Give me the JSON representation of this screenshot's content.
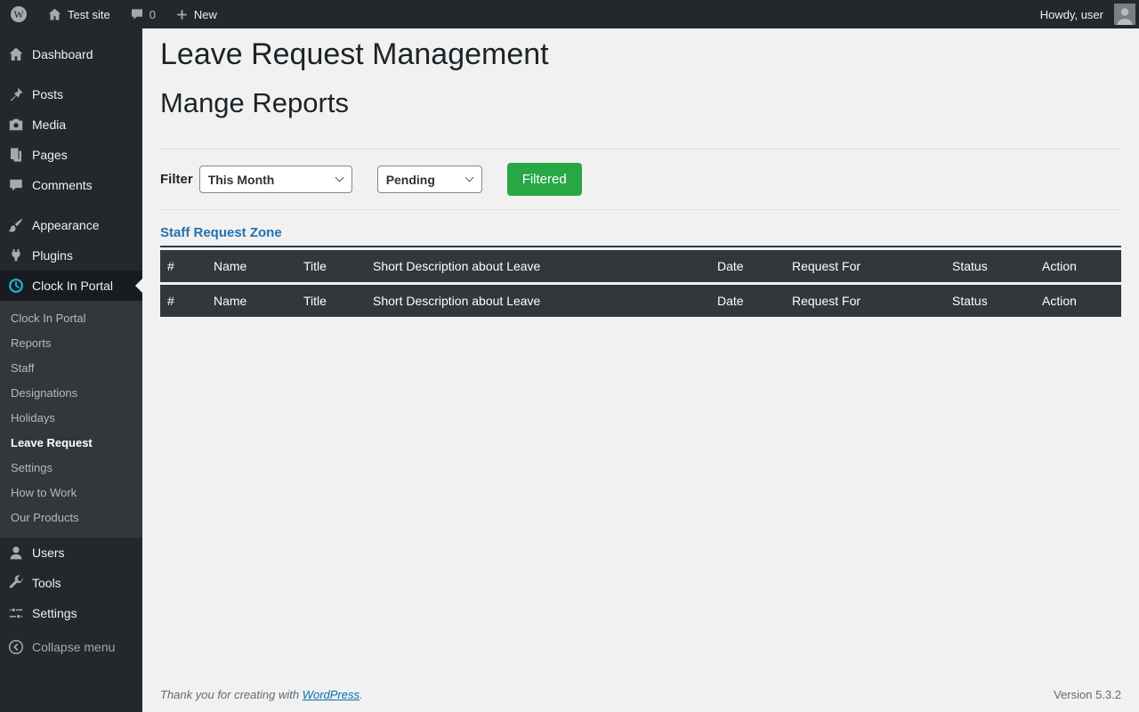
{
  "admin_bar": {
    "site_name": "Test site",
    "comments_count": "0",
    "new_label": "New",
    "howdy_text": "Howdy, user"
  },
  "sidebar": {
    "items": [
      {
        "label": "Dashboard"
      },
      {
        "label": "Posts"
      },
      {
        "label": "Media"
      },
      {
        "label": "Pages"
      },
      {
        "label": "Comments"
      },
      {
        "label": "Appearance"
      },
      {
        "label": "Plugins"
      },
      {
        "label": "Clock In Portal"
      },
      {
        "label": "Users"
      },
      {
        "label": "Tools"
      },
      {
        "label": "Settings"
      }
    ],
    "submenu": [
      {
        "label": "Clock In Portal"
      },
      {
        "label": "Reports"
      },
      {
        "label": "Staff"
      },
      {
        "label": "Designations"
      },
      {
        "label": "Holidays"
      },
      {
        "label": "Leave Request",
        "current": true
      },
      {
        "label": "Settings"
      },
      {
        "label": "How to Work"
      },
      {
        "label": "Our Products"
      }
    ],
    "collapse_label": "Collapse menu"
  },
  "page": {
    "title": "Leave Request Management",
    "subtitle": "Mange Reports",
    "filter": {
      "label": "Filter",
      "period_selected": "This Month",
      "status_selected": "Pending",
      "button_label": "Filtered"
    },
    "section_title": "Staff Request Zone",
    "table": {
      "columns": [
        "#",
        "Name",
        "Title",
        "Short Description about Leave",
        "Date",
        "Request For",
        "Status",
        "Action"
      ],
      "rows": [
        [
          "#",
          "Name",
          "Title",
          "Short Description about Leave",
          "Date",
          "Request For",
          "Status",
          "Action"
        ]
      ]
    }
  },
  "footer": {
    "thanks_text": "Thank you for creating with",
    "wordpress_link": "WordPress",
    "period": ".",
    "version": "Version 5.3.2"
  },
  "colors": {
    "admin_dark": "#23282d",
    "submenu_bg": "#32373c",
    "current_item_bg": "#181c20",
    "content_bg": "#f1f1f1",
    "accent_green": "#28a745",
    "section_blue": "#2271b1",
    "table_header_bg": "#32373c",
    "clock_icon_teal": "#1fb6cf"
  },
  "icons": [
    "wordpress-logo",
    "home",
    "comment-bubble",
    "plus",
    "dashboard-house",
    "posts-pin",
    "media-camera",
    "pages",
    "comments-bubble",
    "appearance-brush",
    "plugins-plug",
    "clock",
    "users-person",
    "tools-wrench",
    "settings-sliders",
    "collapse-arrow",
    "avatar-person",
    "chevron-down"
  ]
}
